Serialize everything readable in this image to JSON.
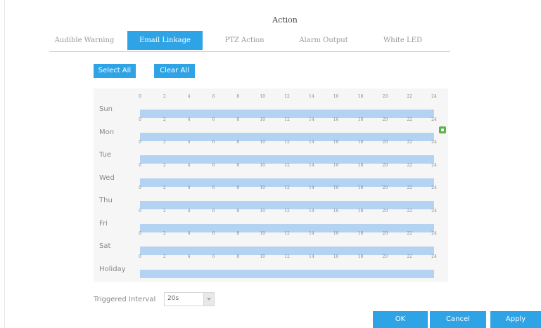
{
  "title": "Action",
  "tabs": [
    {
      "label": "Audible Warning"
    },
    {
      "label": "Email Linkage"
    },
    {
      "label": "PTZ Action"
    },
    {
      "label": "Alarm Output"
    },
    {
      "label": "White LED"
    }
  ],
  "buttons": {
    "select_all": "Select All",
    "clear_all": "Clear All",
    "ok": "OK",
    "cancel": "Cancel",
    "apply": "Apply"
  },
  "schedule": {
    "hours": [
      "0",
      "2",
      "4",
      "6",
      "8",
      "10",
      "12",
      "14",
      "16",
      "18",
      "20",
      "22",
      "24"
    ],
    "days": [
      "Sun",
      "Mon",
      "Tue",
      "Wed",
      "Thu",
      "Fri",
      "Sat",
      "Holiday"
    ],
    "selected_fraction": [
      1,
      1,
      1,
      1,
      1,
      1,
      1,
      1
    ],
    "bar_color": "#b4d3f3"
  },
  "interval": {
    "label": "Triggered Interval",
    "value": "20s"
  },
  "colors": {
    "accent": "#2ea4e6",
    "save_icon": "#5bb24a"
  },
  "icons": {
    "save": "save-icon",
    "dropdown": "chevron-down-icon"
  }
}
